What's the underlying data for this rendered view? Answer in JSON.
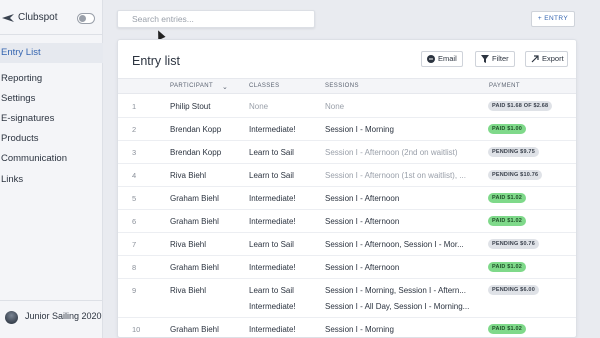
{
  "sidebar": {
    "brand": "Clubspot",
    "items": [
      {
        "label": "Entry List"
      },
      {
        "label": "Reporting"
      },
      {
        "label": "Settings"
      },
      {
        "label": "E-signatures"
      },
      {
        "label": "Products"
      },
      {
        "label": "Communication"
      },
      {
        "label": "Links"
      }
    ],
    "season": "Junior Sailing 2020"
  },
  "topbar": {
    "search_placeholder": "Search entries...",
    "add_entry_label": "+ ENTRY"
  },
  "card": {
    "title": "Entry list",
    "email_label": "Email",
    "filter_label": "Filter",
    "export_label": "Export"
  },
  "table": {
    "headers": {
      "participant": "PARTICIPANT",
      "classes": "CLASSES",
      "sessions": "SESSIONS",
      "payment": "PAYMENT"
    },
    "rows": [
      {
        "num": "1",
        "participant": "Philip Stout",
        "classes": [
          "None"
        ],
        "sessions": [
          "None"
        ],
        "payment": "PAID $1.68 OF $2.68",
        "status": "partial",
        "classes_muted": true,
        "sessions_muted": true
      },
      {
        "num": "2",
        "participant": "Brendan Kopp",
        "classes": [
          "Intermediate!"
        ],
        "sessions": [
          "Session I - Morning"
        ],
        "payment": "PAID $1.00",
        "status": "paid"
      },
      {
        "num": "3",
        "participant": "Brendan Kopp",
        "classes": [
          "Learn to Sail"
        ],
        "sessions": [
          "Session I - Afternoon (2nd on waitlist)"
        ],
        "payment": "PENDING $9.75",
        "status": "pending",
        "sessions_muted": true
      },
      {
        "num": "4",
        "participant": "Riva Biehl",
        "classes": [
          "Learn to Sail"
        ],
        "sessions": [
          "Session I - Afternoon (1st on waitlist), ..."
        ],
        "payment": "PENDING $10.76",
        "status": "pending",
        "sessions_muted": true
      },
      {
        "num": "5",
        "participant": "Graham Biehl",
        "classes": [
          "Intermediate!"
        ],
        "sessions": [
          "Session I - Afternoon"
        ],
        "payment": "PAID $1.02",
        "status": "paid"
      },
      {
        "num": "6",
        "participant": "Graham Biehl",
        "classes": [
          "Intermediate!"
        ],
        "sessions": [
          "Session I - Afternoon"
        ],
        "payment": "PAID $1.02",
        "status": "paid"
      },
      {
        "num": "7",
        "participant": "Riva Biehl",
        "classes": [
          "Learn to Sail"
        ],
        "sessions": [
          "Session I - Afternoon, Session I - Mor..."
        ],
        "payment": "PENDING $0.76",
        "status": "pending"
      },
      {
        "num": "8",
        "participant": "Graham Biehl",
        "classes": [
          "Intermediate!"
        ],
        "sessions": [
          "Session I - Afternoon"
        ],
        "payment": "PAID $1.02",
        "status": "paid"
      },
      {
        "num": "9",
        "participant": "Riva Biehl",
        "classes": [
          "Learn to Sail",
          "Intermediate!"
        ],
        "sessions": [
          "Session I - Morning, Session I - Aftern...",
          "Session I - All Day, Session I - Morning..."
        ],
        "payment": "PENDING $6.00",
        "status": "pending"
      },
      {
        "num": "10",
        "participant": "Graham Biehl",
        "classes": [
          "Intermediate!"
        ],
        "sessions": [
          "Session I - Morning"
        ],
        "payment": "PAID $1.02",
        "status": "paid"
      }
    ]
  },
  "colors": {
    "accent": "#3565b0",
    "paid": "#7fd98a",
    "pending": "#dfe2e7"
  }
}
